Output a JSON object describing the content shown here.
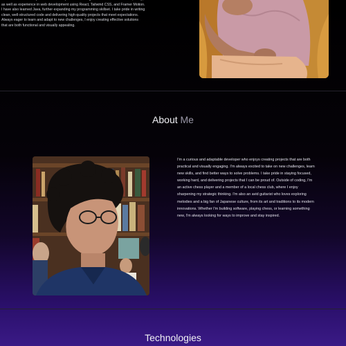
{
  "intro": {
    "text": "I am a motivated and passionate developer who is doing hands-on in CS. Full Line, Unity, as well as experience in web development using React, Tailwind CSS, and Framer Motion. I have also learned Java, further expanding my programming skillset. I take pride in writing clean, well-structured code and delivering high-quality projects that meet expectations. Always eager to learn and adapt to new challenges, I enjoy creating effective solutions that are both functional and visually appealing."
  },
  "about": {
    "title_main": "About",
    "title_accent": "Me",
    "text": "I'm a curious and adaptable developer who enjoys creating projects that are both practical and visually engaging. I'm always excited to take on new challenges, learn new skills, and find better ways to solve problems. I take pride in staying focused, working hard, and delivering projects that I can be proud of. Outside of coding, I'm an active chess player and a member of a local chess club, where I enjoy sharpening my strategic thinking. I'm also an avid guitarist who loves exploring melodies and a big fan of Japanese culture, from its art and traditions to its modern innovations. Whether I'm building software, playing chess, or learning something new, I'm always looking for ways to improve and stay inspired."
  },
  "technologies": {
    "title": "Technologies"
  },
  "colors": {
    "background_top": "#000000",
    "background_bottom": "#3a1a86",
    "accent_text": "#9b98a8"
  }
}
